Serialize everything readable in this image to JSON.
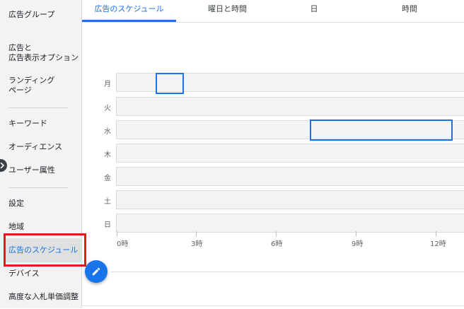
{
  "sidebar": {
    "items": [
      {
        "label": "広告グループ"
      },
      {
        "label": "広告と"
      },
      {
        "label": "広告表示オプション"
      },
      {
        "label": "ランディング"
      },
      {
        "label": "ページ"
      },
      {
        "label": "キーワード"
      },
      {
        "label": "オーディエンス"
      },
      {
        "label": "ユーザー属性"
      },
      {
        "label": "設定"
      },
      {
        "label": "地域"
      },
      {
        "label": "広告のスケジュール"
      },
      {
        "label": "デバイス"
      },
      {
        "label": "高度な入札単価調整"
      }
    ],
    "selected": "広告のスケジュール",
    "highlight_color": "#e51b1b"
  },
  "tabs": [
    {
      "label": "広告のスケジュール",
      "active": true
    },
    {
      "label": "曜日と時間",
      "active": false
    },
    {
      "label": "日",
      "active": false
    },
    {
      "label": "時間",
      "active": false
    }
  ],
  "schedule": {
    "days": [
      "月",
      "火",
      "水",
      "木",
      "金",
      "土",
      "日"
    ],
    "hours": [
      "0時",
      "3時",
      "6時",
      "9時",
      "12時"
    ]
  },
  "colors": {
    "accent": "#1a73e8",
    "fab": "#1a73e8"
  },
  "icons": {
    "fab": "pencil-icon",
    "toggle": "chevron-right-icon"
  }
}
